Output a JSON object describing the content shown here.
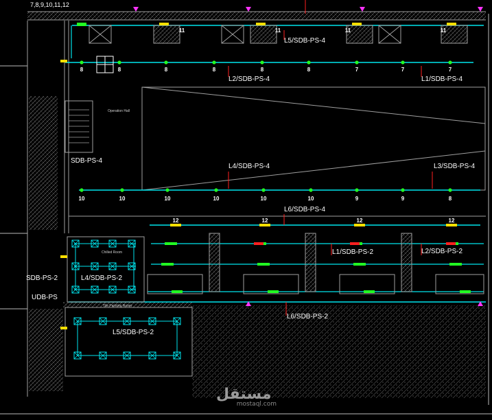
{
  "header_label": "7,8,9,10,11,12",
  "circuit_labels": [
    {
      "id": "l5-top",
      "text": "L5/SDB-PS-4"
    },
    {
      "id": "l2-top",
      "text": "L2/SDB-PS-4"
    },
    {
      "id": "l1-top",
      "text": "L1/SDB-PS-4"
    },
    {
      "id": "l4-mid",
      "text": "L4/SDB-PS-4"
    },
    {
      "id": "l3-mid",
      "text": "L3/SDB-PS-4"
    },
    {
      "id": "l6-mid",
      "text": "L6/SDB-PS-4"
    },
    {
      "id": "l1-lower",
      "text": "L1/SDB-PS-2"
    },
    {
      "id": "l2-lower",
      "text": "L2/SDB-PS-2"
    },
    {
      "id": "l4-lower",
      "text": "L4/SDB-PS-2"
    },
    {
      "id": "l6-lower",
      "text": "L6/SDB-PS-2"
    },
    {
      "id": "l5-lower",
      "text": "L5/SDB-PS-2"
    }
  ],
  "panel_labels": {
    "sdb_ps_4": "SDB-PS-4",
    "sdb_ps_2": "SDB-PS-2",
    "udb_ps": "UDB-PS"
  },
  "row1_numbers": [
    "11",
    "11",
    "11",
    "11"
  ],
  "row2_numbers": [
    "8",
    "8",
    "8",
    "8",
    "8",
    "8",
    "7",
    "7",
    "7"
  ],
  "row3_numbers": [
    "10",
    "10",
    "10",
    "10",
    "10",
    "10",
    "9",
    "9",
    "8"
  ],
  "row4_numbers": [
    "12",
    "12",
    "12",
    "12"
  ],
  "room_labels": {
    "operation_hall": "Operation Hall",
    "cold_room": "Chilled Room",
    "bottom_room": "Tile Painting Room"
  },
  "watermark": {
    "logo": "مستقل",
    "url": "mostaql.com"
  },
  "colors": {
    "background": "#000000",
    "cyan_wire": "#00e5ee",
    "green_fixture": "#22ff22",
    "red_leader": "#ff2020",
    "yellow_panel": "#ffe000",
    "magenta_marker": "#ff33ff",
    "wall_gray": "#a0a0a0"
  }
}
